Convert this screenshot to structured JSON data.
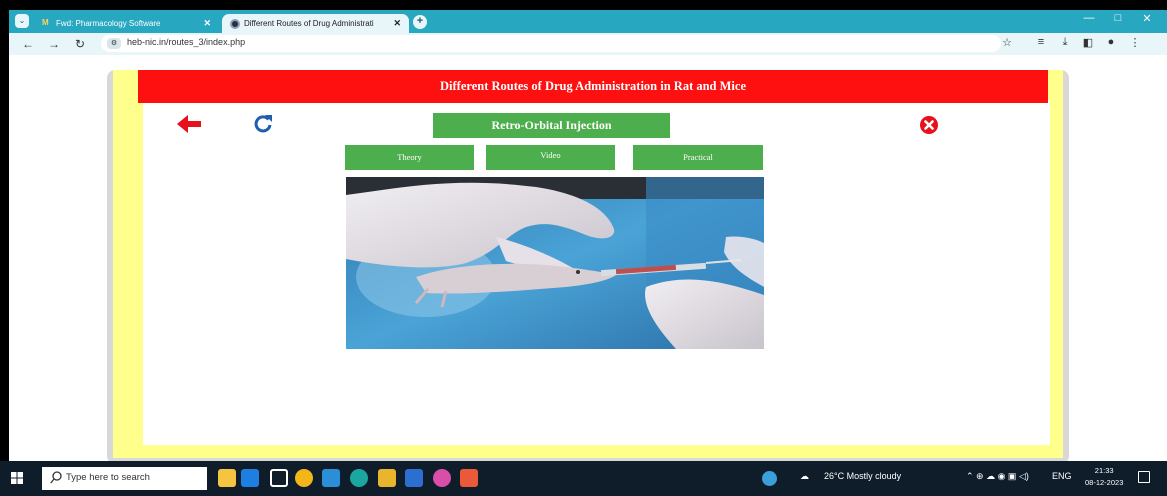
{
  "browser": {
    "tabs": [
      {
        "title": "Fwd: Pharmacology Software",
        "close": "✕"
      },
      {
        "title": "Different Routes of Drug Administration",
        "close": "✕"
      }
    ],
    "new_tab": "+",
    "url": "heb-nic.in/routes_3/index.php",
    "window_controls": [
      "—",
      "□",
      "✕"
    ]
  },
  "page": {
    "banner_title": "Different Routes of Drug Administration in Rat and Mice",
    "topic_title": "Retro-Orbital Injection",
    "buttons": {
      "theory": "Theory",
      "video": "Video",
      "practical": "Practical"
    }
  },
  "taskbar": {
    "search_placeholder": "Type here to search",
    "weather": "26°C  Mostly cloudy",
    "language": "ENG",
    "time": "21:33",
    "date": "08-12-2023"
  },
  "colors": {
    "banner": "#ff1010",
    "button": "#4cae4c",
    "frame": "#ffff8c",
    "tabstrip": "#28a7c0"
  }
}
